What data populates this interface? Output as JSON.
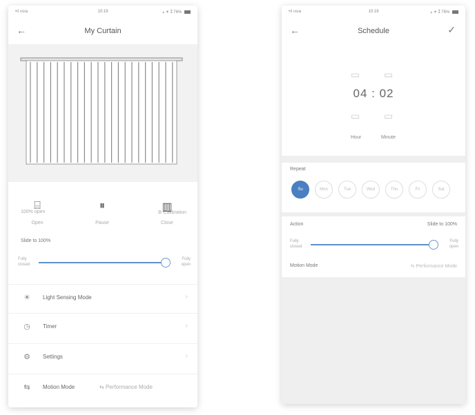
{
  "left": {
    "status": {
      "carrier": "•ıl ıısıa",
      "time": "10:19",
      "right": "⁎ ✶ ⁑ 76% "
    },
    "nav": {
      "back": "←",
      "title": "My Curtain"
    },
    "curtain": {
      "foot_left": "100% open",
      "foot_right": "⚙ Calibration"
    },
    "controls": [
      {
        "icon": "⌸",
        "label": "Open"
      },
      {
        "icon": "⏸",
        "label": "Pause"
      },
      {
        "icon": "▥",
        "label": "Close"
      }
    ],
    "slide_label": "Slide to 100%",
    "slider": {
      "left": "Fully\nclosed",
      "right": "Fully\nopen",
      "value": 1.0
    },
    "menu": [
      {
        "icon": "☀",
        "label": "Light Sensing Mode"
      },
      {
        "icon": "◷",
        "label": "Timer"
      },
      {
        "icon": "⚙",
        "label": "Settings"
      },
      {
        "icon": "⇆",
        "label": "Motion Mode",
        "value": "⇆ Performance Mode"
      }
    ]
  },
  "right": {
    "status": {
      "carrier": "•ıl ıısıa",
      "time": "10:19",
      "right": "⁎ ✶ ⁑ 76% "
    },
    "nav": {
      "back": "←",
      "title": "Schedule",
      "ok": "✓"
    },
    "time": {
      "display": "04 : 02",
      "hour_label": "Hour",
      "minute_label": "Minute"
    },
    "repeat_label": "Repeat",
    "days": [
      {
        "label": "Su",
        "active": true
      },
      {
        "label": "Mon",
        "active": false
      },
      {
        "label": "Tue",
        "active": false
      },
      {
        "label": "Wed",
        "active": false
      },
      {
        "label": "Thu",
        "active": false
      },
      {
        "label": "Fri",
        "active": false
      },
      {
        "label": "Sat",
        "active": false
      }
    ],
    "action": {
      "label": "Action",
      "value": "Slide to 100%"
    },
    "slider": {
      "left": "Fully\nclosed",
      "right": "Fully\nopen",
      "value": 1.0
    },
    "mode": {
      "label": "Motion Mode",
      "value": "⇆ Performance Mode"
    }
  },
  "colors": {
    "accent": "#4a7fc1",
    "track": "#5b8fc9"
  }
}
